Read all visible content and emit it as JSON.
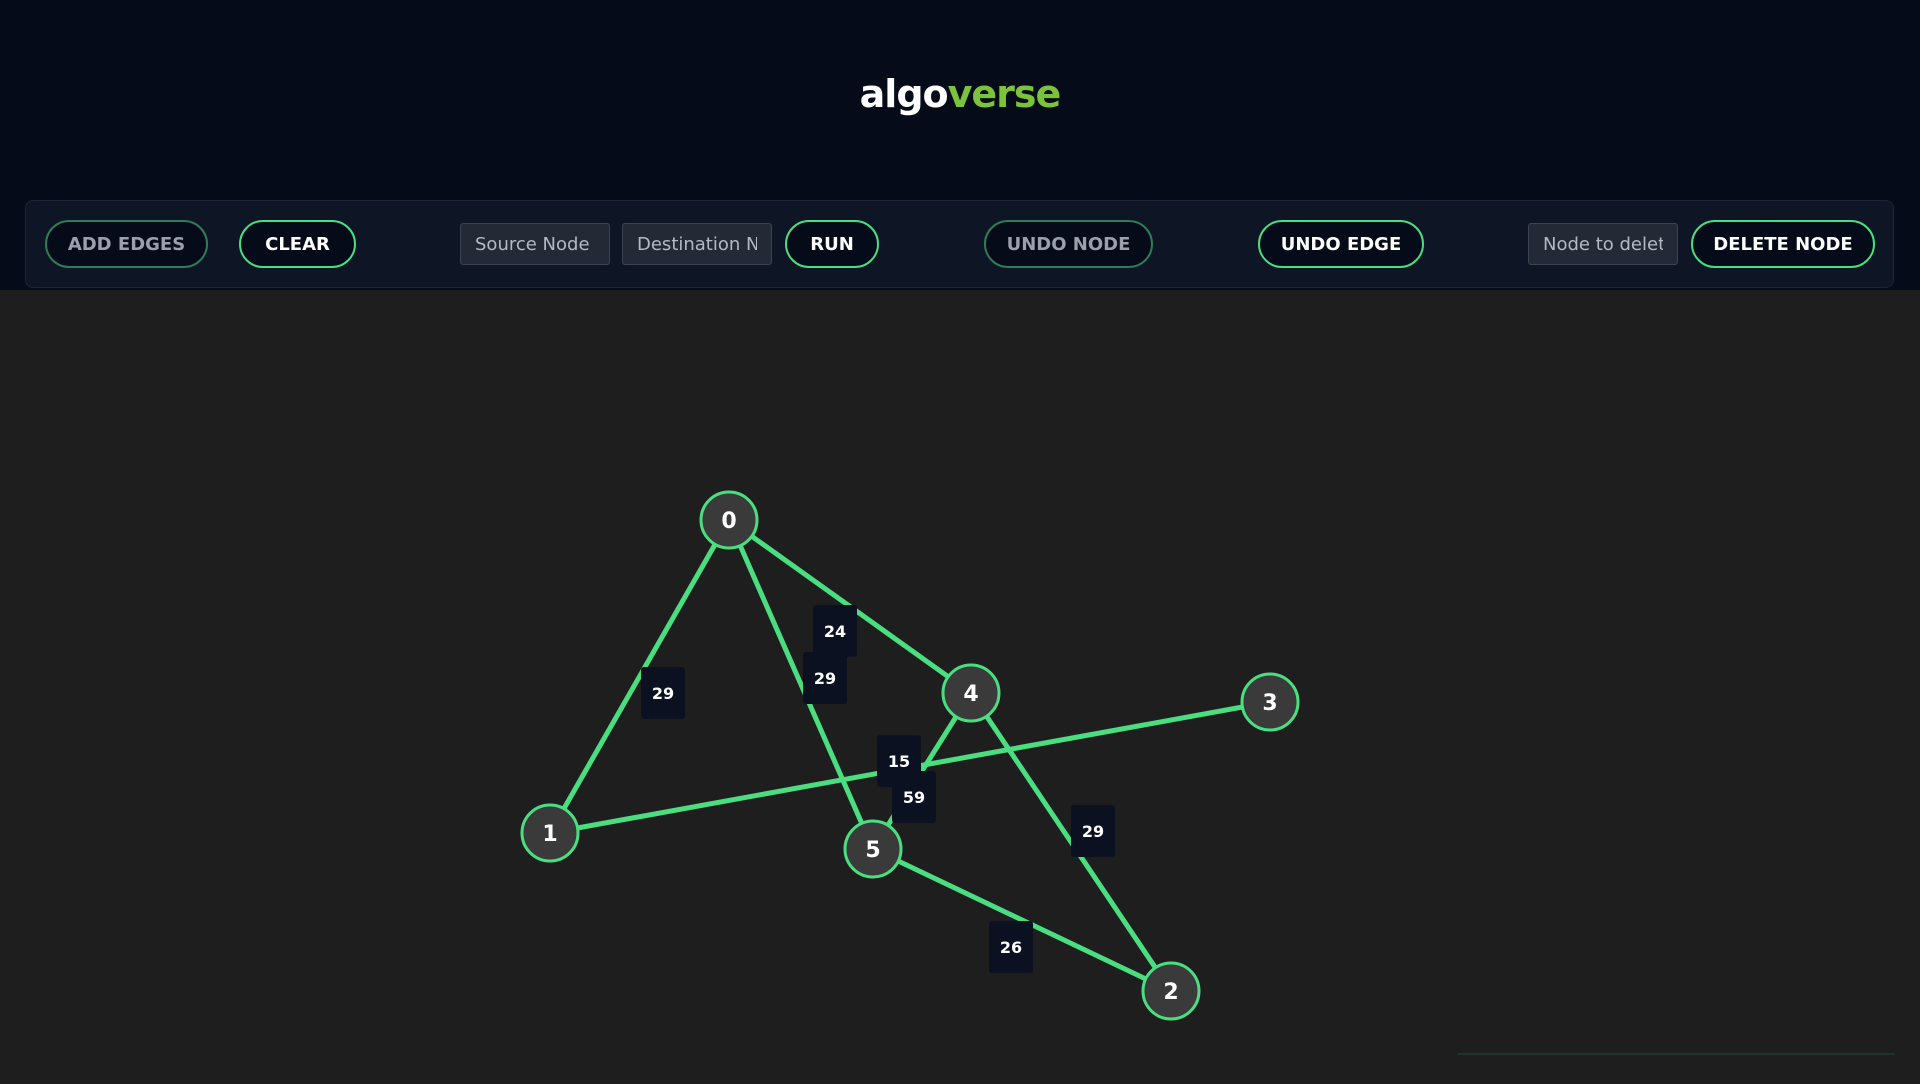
{
  "app": {
    "logo_part1": "algo",
    "logo_part2": "verse"
  },
  "toolbar": {
    "add_edges_label": "ADD EDGES",
    "clear_label": "CLEAR",
    "source_placeholder": "Source Node",
    "destination_placeholder": "Destination Node",
    "run_label": "RUN",
    "undo_node_label": "UNDO NODE",
    "undo_edge_label": "UNDO EDGE",
    "delete_placeholder": "Node to delete",
    "delete_node_label": "DELETE NODE"
  },
  "colors": {
    "header_bg": "#050b19",
    "canvas_bg": "#1e1e1e",
    "accent": "#4ade80",
    "logo_accent": "#7cc23a",
    "node_fill": "#3a3a3a",
    "weight_bg": "#0b1120"
  },
  "graph": {
    "nodes": [
      {
        "id": "0",
        "label": "0"
      },
      {
        "id": "1",
        "label": "1"
      },
      {
        "id": "2",
        "label": "2"
      },
      {
        "id": "3",
        "label": "3"
      },
      {
        "id": "4",
        "label": "4"
      },
      {
        "id": "5",
        "label": "5"
      }
    ],
    "edges": [
      {
        "from": "0",
        "to": "1",
        "weight": "29"
      },
      {
        "from": "0",
        "to": "4",
        "weight": "24"
      },
      {
        "from": "0",
        "to": "5",
        "weight": "29"
      },
      {
        "from": "4",
        "to": "5",
        "weight": "15"
      },
      {
        "from": "1",
        "to": "3",
        "weight": "59"
      },
      {
        "from": "4",
        "to": "2",
        "weight": "29"
      },
      {
        "from": "5",
        "to": "2",
        "weight": "26"
      }
    ]
  }
}
